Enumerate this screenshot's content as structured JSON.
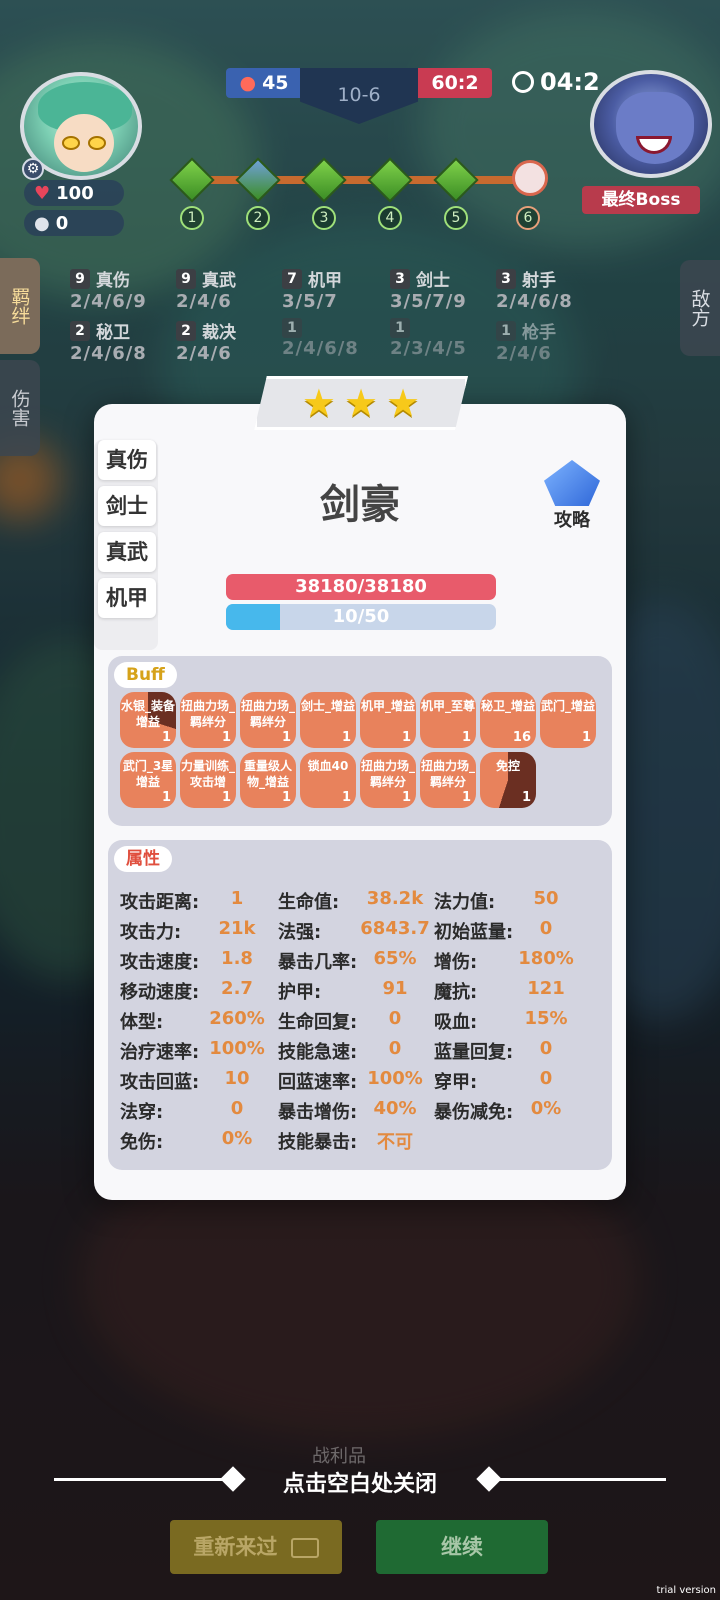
{
  "hud": {
    "player_hp": "100",
    "player_coins": "0",
    "blue_score": "45",
    "round": "10-6",
    "red_score": "60:2",
    "timer": "04:2",
    "boss_label": "最终Boss",
    "stages": [
      "1",
      "2",
      "3",
      "4",
      "5",
      "6"
    ]
  },
  "side_tabs": {
    "bonds": "羁绊",
    "damage": "伤害",
    "enemy": "敌方"
  },
  "synergies": [
    {
      "count": "9",
      "name": "真伤",
      "tiers": "2/4/6/9"
    },
    {
      "count": "9",
      "name": "真武",
      "tiers": "2/4/6"
    },
    {
      "count": "7",
      "name": "机甲",
      "tiers": "3/5/7"
    },
    {
      "count": "3",
      "name": "剑士",
      "tiers": "3/5/7/9"
    },
    {
      "count": "3",
      "name": "射手",
      "tiers": "2/4/6/8"
    },
    {
      "count": "2",
      "name": "秘卫",
      "tiers": "2/4/6/8"
    },
    {
      "count": "2",
      "name": "裁决",
      "tiers": "2/4/6"
    },
    {
      "count": "1",
      "name": "",
      "tiers": "2/4/6/8"
    },
    {
      "count": "1",
      "name": "",
      "tiers": "2/3/4/5"
    },
    {
      "count": "1",
      "name": "枪手",
      "tiers": "2/4/6"
    }
  ],
  "hero": {
    "stars": 3,
    "name": "剑豪",
    "traits": [
      "真伤",
      "剑士",
      "真武",
      "机甲"
    ],
    "guide_label": "攻略",
    "hp": "38180/38180",
    "mana_text": "10/50",
    "mana_fraction": 0.2
  },
  "buff": {
    "title": "Buff",
    "items": [
      {
        "label": "水银_装备增益",
        "count": "1",
        "style": "pie"
      },
      {
        "label": "扭曲力场_羁绊分",
        "count": "1",
        "style": ""
      },
      {
        "label": "扭曲力场_羁绊分",
        "count": "1",
        "style": ""
      },
      {
        "label": "剑士_增益",
        "count": "1",
        "style": ""
      },
      {
        "label": "机甲_增益",
        "count": "1",
        "style": ""
      },
      {
        "label": "机甲_至尊",
        "count": "1",
        "style": ""
      },
      {
        "label": "秘卫_增益",
        "count": "16",
        "style": ""
      },
      {
        "label": "武门_增益",
        "count": "1",
        "style": ""
      },
      {
        "label": "武门_3星增益",
        "count": "1",
        "style": ""
      },
      {
        "label": "力量训练_攻击增",
        "count": "1",
        "style": ""
      },
      {
        "label": "重量级人物_增益",
        "count": "1",
        "style": ""
      },
      {
        "label": "锁血40",
        "count": "1",
        "style": ""
      },
      {
        "label": "扭曲力场_羁绊分",
        "count": "1",
        "style": ""
      },
      {
        "label": "扭曲力场_羁绊分",
        "count": "1",
        "style": ""
      },
      {
        "label": "免控",
        "count": "1",
        "style": "pie2"
      }
    ]
  },
  "attributes": {
    "title": "属性",
    "rows": [
      [
        [
          "攻击距离:",
          "1"
        ],
        [
          "生命值:",
          "38.2k"
        ],
        [
          "法力值:",
          "50"
        ]
      ],
      [
        [
          "攻击力:",
          "21k"
        ],
        [
          "法强:",
          "6843.7"
        ],
        [
          "初始蓝量:",
          "0"
        ]
      ],
      [
        [
          "攻击速度:",
          "1.8"
        ],
        [
          "暴击几率:",
          "65%"
        ],
        [
          "增伤:",
          "180%"
        ]
      ],
      [
        [
          "移动速度:",
          "2.7"
        ],
        [
          "护甲:",
          "91"
        ],
        [
          "魔抗:",
          "121"
        ]
      ],
      [
        [
          "体型:",
          "260%"
        ],
        [
          "生命回复:",
          "0"
        ],
        [
          "吸血:",
          "15%"
        ]
      ],
      [
        [
          "治疗速率:",
          "100%"
        ],
        [
          "技能急速:",
          "0"
        ],
        [
          "蓝量回复:",
          "0"
        ]
      ],
      [
        [
          "攻击回蓝:",
          "10"
        ],
        [
          "回蓝速率:",
          "100%"
        ],
        [
          "穿甲:",
          "0"
        ]
      ],
      [
        [
          "法穿:",
          "0"
        ],
        [
          "暴击增伤:",
          "40%"
        ],
        [
          "暴伤减免:",
          "0%"
        ]
      ],
      [
        [
          "免伤:",
          "0%"
        ],
        [
          "技能暴击:",
          "不可"
        ],
        null
      ]
    ]
  },
  "footer": {
    "loot": "战利品",
    "close_hint": "点击空白处关闭",
    "retry": "重新来过",
    "continue": "继续",
    "trial": "trial version"
  },
  "colors": {
    "hp_bar": "#e85b6b",
    "mana_bar": "#47b8ec",
    "buff_tile": "#e8825c",
    "attr_value": "#e38a3f",
    "star": "#f7c91a"
  }
}
